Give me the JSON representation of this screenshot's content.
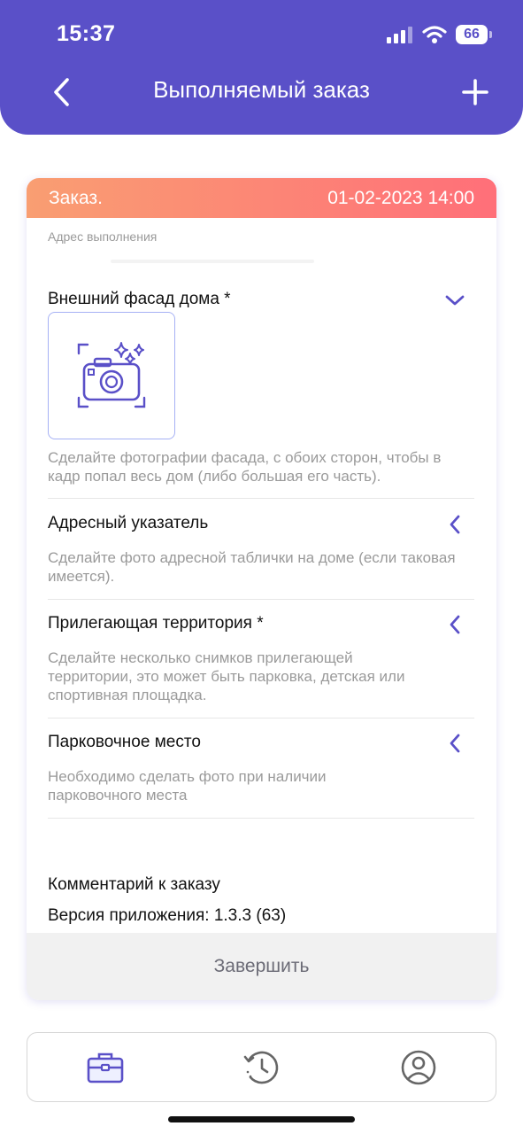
{
  "status_bar": {
    "time": "15:37",
    "battery": "66"
  },
  "header": {
    "title": "Выполняемый заказ"
  },
  "order": {
    "label": "Заказ.",
    "datetime": "01-02-2023 14:00",
    "address_label": "Адрес выполнения"
  },
  "sections": [
    {
      "title": "Внешний фасад дома *",
      "description": "Сделайте фотографии фасада, с обоих сторон, чтобы в кадр попал весь дом (либо большая его часть).",
      "expanded": true
    },
    {
      "title": "Адресный указатель",
      "description": "Сделайте фото адресной таблички на доме (если таковая имеется).",
      "expanded": false
    },
    {
      "title": "Прилегающая территория *",
      "description": "Сделайте несколько снимков прилегающей территории, это может быть парковка, детская или спортивная площадка.",
      "expanded": false
    },
    {
      "title": "Парковочное место",
      "description": "Необходимо сделать фото при наличии парковочного места",
      "expanded": false
    }
  ],
  "comment_label": "Комментарий к заказу",
  "version_text": "Версия приложения: 1.3.3 (63)",
  "finish_label": "Завершить",
  "colors": {
    "header": "#5a50c8",
    "accent": "#5a50c8",
    "order_gradient_start": "#f99e72",
    "order_gradient_end": "#ff6f79"
  },
  "tabs": [
    {
      "icon": "briefcase-icon",
      "active": true
    },
    {
      "icon": "history-icon",
      "active": false
    },
    {
      "icon": "profile-icon",
      "active": false
    }
  ]
}
